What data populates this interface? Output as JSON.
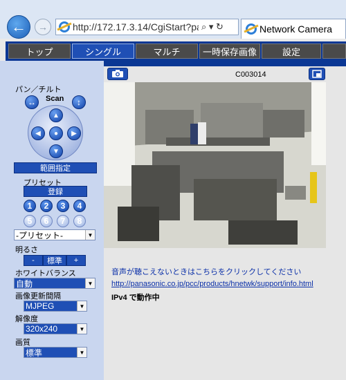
{
  "browser": {
    "address": "http://172.17.3.14/CgiStart?pag",
    "tab_title": "Network Camera",
    "address_tools": "⌕ ▾ ↻"
  },
  "menu": {
    "tabs": [
      "トップ",
      "シングル",
      "マルチ",
      "一時保存画像",
      "設定"
    ],
    "active": "シングル"
  },
  "controls": {
    "pan_tilt_label": "パン／チルト",
    "scan_label": "Scan",
    "range_button": "範囲指定",
    "preset_label": "プリセット",
    "register_button": "登録",
    "preset_numbers": [
      "1",
      "2",
      "3",
      "4",
      "5",
      "6",
      "7",
      "8"
    ],
    "preset_select": "-プリセット-",
    "brightness_label": "明るさ",
    "brightness_minus": "-",
    "brightness_standard": "標準",
    "brightness_plus": "+",
    "white_balance_label": "ホワイトバランス",
    "white_balance_value": "自動",
    "refresh_label": "画像更新間隔",
    "refresh_value": "MJPEG",
    "resolution_label": "解像度",
    "resolution_value": "320x240",
    "quality_label": "画質",
    "quality_value": "標準"
  },
  "viewer": {
    "camera_name": "C003014",
    "audio_notice": "音声が聴こえないときはこちらをクリックしてください",
    "support_link": "http://panasonic.co.jp/pcc/products/hnetwk/support/info.html",
    "ip_status": "IPv4 で動作中"
  },
  "colors": {
    "nav_blue": "#0b3794",
    "button_blue": "#1f4fb5",
    "panel_bg": "#c9d6ef",
    "link_blue": "#0a2fa8"
  }
}
